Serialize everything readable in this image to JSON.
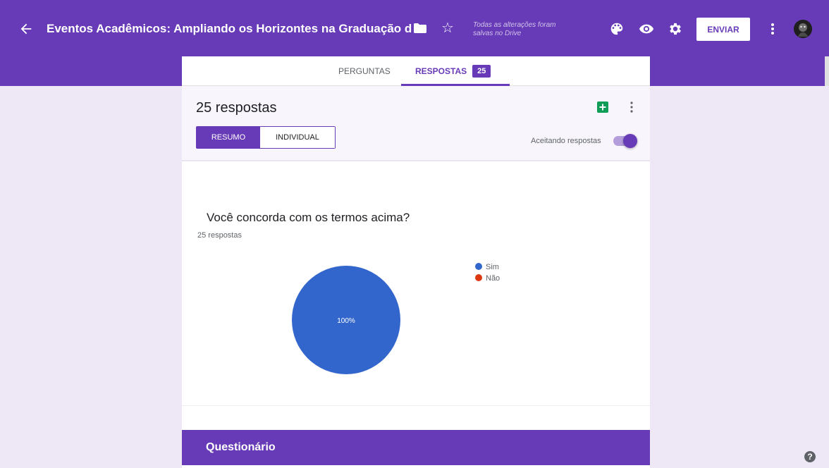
{
  "header": {
    "title": "Eventos Acadêmicos: Ampliando os Horizontes na Graduação de I",
    "saved_status": "Todas as alterações foram salvas no Drive",
    "send_label": "ENVIAR",
    "icons": [
      "back-arrow-icon",
      "folder-icon",
      "star-icon",
      "palette-icon",
      "eye-icon",
      "gear-icon",
      "more-vert-icon",
      "avatar"
    ]
  },
  "tabs": {
    "questions_label": "PERGUNTAS",
    "responses_label": "RESPOSTAS",
    "responses_badge": "25"
  },
  "responses_card": {
    "count_title": "25 respostas",
    "summary_label": "RESUMO",
    "individual_label": "INDIVIDUAL",
    "accepting_label": "Aceitando respostas",
    "accepting_on": true
  },
  "question": {
    "title": "Você concorda com os termos acima?",
    "subtitle": "25 respostas"
  },
  "chart_data": {
    "type": "pie",
    "categories": [
      "Sim",
      "Não"
    ],
    "values": [
      100,
      0
    ],
    "slice_label": "100%",
    "colors": [
      "#3366cc",
      "#dc3912"
    ],
    "legend_position": "right"
  },
  "section": {
    "title": "Questionário"
  },
  "colors": {
    "brand": "#673ab7",
    "background": "#ede7f6"
  }
}
